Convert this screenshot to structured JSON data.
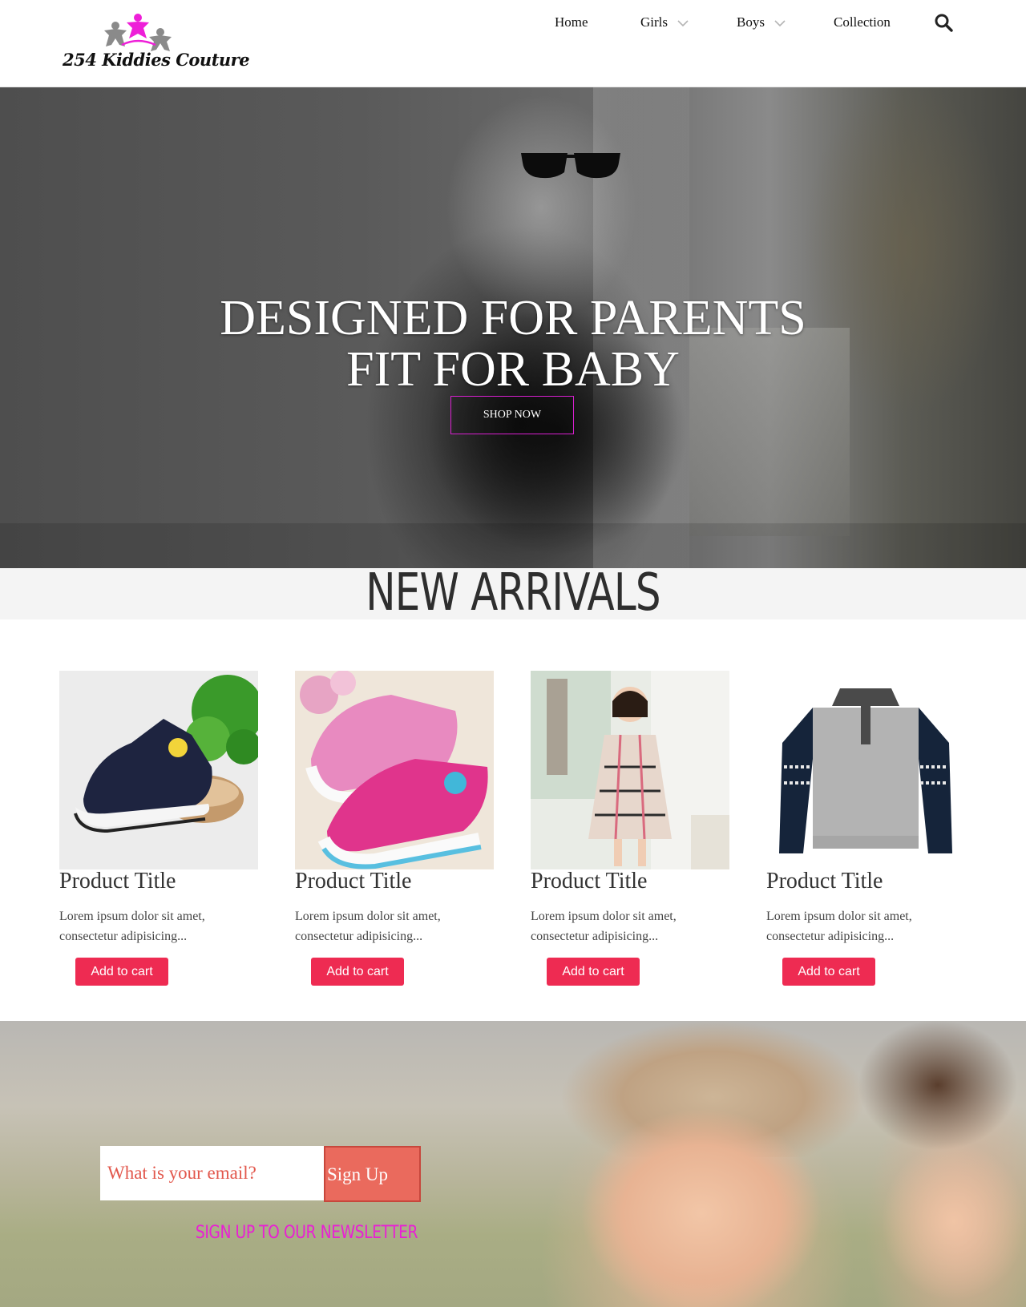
{
  "header": {
    "logo_text": "254 Kiddies Couture",
    "nav": [
      {
        "label": "Home",
        "has_dropdown": false
      },
      {
        "label": "Girls",
        "has_dropdown": true
      },
      {
        "label": "Boys",
        "has_dropdown": true
      },
      {
        "label": "Collection",
        "has_dropdown": false
      }
    ],
    "search_icon": "search-icon"
  },
  "hero": {
    "title_line1": "DESIGNED FOR PARENTS",
    "title_line2": "FIT FOR BABY",
    "cta_label": "SHOP NOW"
  },
  "arrivals": {
    "title": "NEW ARRIVALS",
    "products": [
      {
        "title": "Product Title",
        "description": "Lorem ipsum dolor sit amet, consectetur adipisicing...",
        "button_label": "Add to cart",
        "image": "navy-sneaker"
      },
      {
        "title": "Product Title",
        "description": "Lorem ipsum dolor sit amet, consectetur adipisicing...",
        "button_label": "Add to cart",
        "image": "pink-sneakers"
      },
      {
        "title": "Product Title",
        "description": "Lorem ipsum dolor sit amet, consectetur adipisicing...",
        "button_label": "Add to cart",
        "image": "plaid-dress-girl"
      },
      {
        "title": "Product Title",
        "description": "Lorem ipsum dolor sit amet, consectetur adipisicing...",
        "button_label": "Add to cart",
        "image": "grey-knit-sweater"
      }
    ]
  },
  "newsletter": {
    "email_placeholder": "What is your email?",
    "signup_label": "Sign Up",
    "caption": "SIGN UP TO OUR NEWSLETTER"
  },
  "colors": {
    "accent_pink": "#e91fd4",
    "add_to_cart": "#ee2b52",
    "signup": "#ea6a5d"
  }
}
